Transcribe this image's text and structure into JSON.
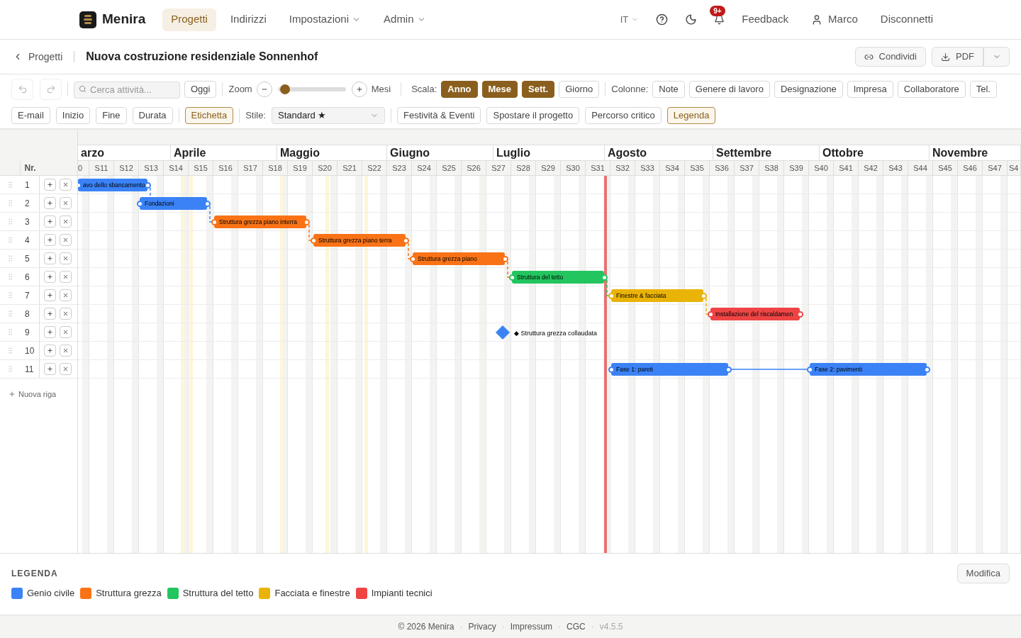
{
  "nav": {
    "brand": "Menira",
    "items": [
      {
        "label": "Progetti",
        "selected": true,
        "dropdown": false
      },
      {
        "label": "Indirizzi",
        "selected": false,
        "dropdown": false
      },
      {
        "label": "Impostazioni",
        "selected": false,
        "dropdown": true
      },
      {
        "label": "Admin",
        "selected": false,
        "dropdown": true
      }
    ],
    "language": "IT",
    "notification_badge": "9+",
    "feedback": "Feedback",
    "user": "Marco",
    "logout": "Disconnetti"
  },
  "project_header": {
    "back": "Progetti",
    "title": "Nuova costruzione residenziale Sonnenhof",
    "share": "Condividi",
    "pdf": "PDF"
  },
  "toolbar": {
    "search_placeholder": "Cerca attività...",
    "today": "Oggi",
    "zoom_label": "Zoom",
    "zoom": {
      "level": 0.05
    },
    "zoom_unit": "Mesi",
    "scale_label": "Scala:",
    "scales": [
      {
        "label": "Anno",
        "selected": true
      },
      {
        "label": "Mese",
        "selected": true
      },
      {
        "label": "Sett.",
        "selected": true
      },
      {
        "label": "Giorno",
        "selected": false
      }
    ],
    "columns_label": "Colonne:",
    "columns": [
      {
        "label": "Note",
        "selected": false
      },
      {
        "label": "Genere di lavoro",
        "selected": false
      },
      {
        "label": "Designazione",
        "selected": false
      },
      {
        "label": "Impresa",
        "selected": false
      },
      {
        "label": "Collaboratore",
        "selected": false
      },
      {
        "label": "Tel.",
        "selected": false
      }
    ],
    "fields": [
      {
        "label": "E-mail",
        "selected": false
      },
      {
        "label": "Inizio",
        "selected": false
      },
      {
        "label": "Fine",
        "selected": false
      },
      {
        "label": "Durata",
        "selected": false
      }
    ],
    "label_toggle": {
      "label": "Etichetta",
      "selected": true
    },
    "style_label": "Stile:",
    "style_value": "Standard ★",
    "options": [
      {
        "label": "Festività & Eventi",
        "selected": false
      },
      {
        "label": "Spostare il progetto",
        "selected": false
      },
      {
        "label": "Percorso critico",
        "selected": false
      },
      {
        "label": "Legenda",
        "selected": true
      }
    ]
  },
  "gantt": {
    "number_header": "Nr.",
    "months": [
      "arzo",
      "Aprile",
      "Maggio",
      "Giugno",
      "Luglio",
      "Agosto",
      "Settembre",
      "Ottobre",
      "Novembre"
    ],
    "weeks": [
      "0",
      "S11",
      "S12",
      "S13",
      "S14",
      "S15",
      "S16",
      "S17",
      "S18",
      "S19",
      "S20",
      "S21",
      "S22",
      "S23",
      "S24",
      "S25",
      "S26",
      "S27",
      "S28",
      "S29",
      "S30",
      "S31",
      "S32",
      "S33",
      "S34",
      "S35",
      "S36",
      "S37",
      "S38",
      "S39",
      "S40",
      "S41",
      "S42",
      "S43",
      "S44",
      "S45",
      "S46",
      "S47",
      "S4"
    ],
    "rows": [
      {
        "number": "1",
        "bars": [
          {
            "kind": "bar",
            "label": "avo dello sbancamento",
            "color": "#3b82f6"
          }
        ]
      },
      {
        "number": "2",
        "bars": [
          {
            "kind": "bar",
            "label": "Fondazioni",
            "color": "#3b82f6"
          }
        ]
      },
      {
        "number": "3",
        "bars": [
          {
            "kind": "bar",
            "label": "Struttura grezza piano interra",
            "color": "#f97316"
          }
        ]
      },
      {
        "number": "4",
        "bars": [
          {
            "kind": "bar",
            "label": "Struttura grezza piano terra",
            "color": "#f97316"
          }
        ]
      },
      {
        "number": "5",
        "bars": [
          {
            "kind": "bar",
            "label": "Struttura grezza piano",
            "color": "#f97316"
          }
        ]
      },
      {
        "number": "6",
        "bars": [
          {
            "kind": "bar",
            "label": "Struttura del tetto",
            "color": "#22c55e"
          }
        ]
      },
      {
        "number": "7",
        "bars": [
          {
            "kind": "bar",
            "label": "Finestre & facciata",
            "color": "#eab308"
          }
        ]
      },
      {
        "number": "8",
        "bars": [
          {
            "kind": "bar",
            "label": "Installazione del riscaldamen",
            "color": "#ef4444"
          }
        ]
      },
      {
        "number": "9",
        "bars": [
          {
            "kind": "milestone",
            "label": "◆ Struttura grezza collaudata",
            "color": "#3b82f6"
          }
        ]
      },
      {
        "number": "10",
        "bars": []
      },
      {
        "number": "11",
        "bars": [
          {
            "kind": "bar",
            "label": "Fase 1: pareti",
            "color": "#3b82f6"
          },
          {
            "kind": "bar",
            "label": "Fase 2: pavimenti",
            "color": "#3b82f6"
          }
        ]
      }
    ],
    "new_row": "Nuova riga"
  },
  "legend": {
    "title": "LEGENDA",
    "edit": "Modifica",
    "items": [
      {
        "label": "Genio civile",
        "color": "#3b82f6"
      },
      {
        "label": "Struttura grezza",
        "color": "#f97316"
      },
      {
        "label": "Struttura del tetto",
        "color": "#22c55e"
      },
      {
        "label": "Facciata e finestre",
        "color": "#eab308"
      },
      {
        "label": "Impianti tecnici",
        "color": "#ef4444"
      }
    ]
  },
  "footer": {
    "items": [
      {
        "kind": "text",
        "label": "© 2026 Menira"
      },
      {
        "kind": "separator",
        "label": "·"
      },
      {
        "kind": "link",
        "label": "Privacy"
      },
      {
        "kind": "separator",
        "label": "·"
      },
      {
        "kind": "link",
        "label": "Impressum"
      },
      {
        "kind": "separator",
        "label": "·"
      },
      {
        "kind": "link",
        "label": "CGC"
      },
      {
        "kind": "separator",
        "label": "·"
      },
      {
        "kind": "version",
        "label": "v4.5.5"
      }
    ]
  }
}
